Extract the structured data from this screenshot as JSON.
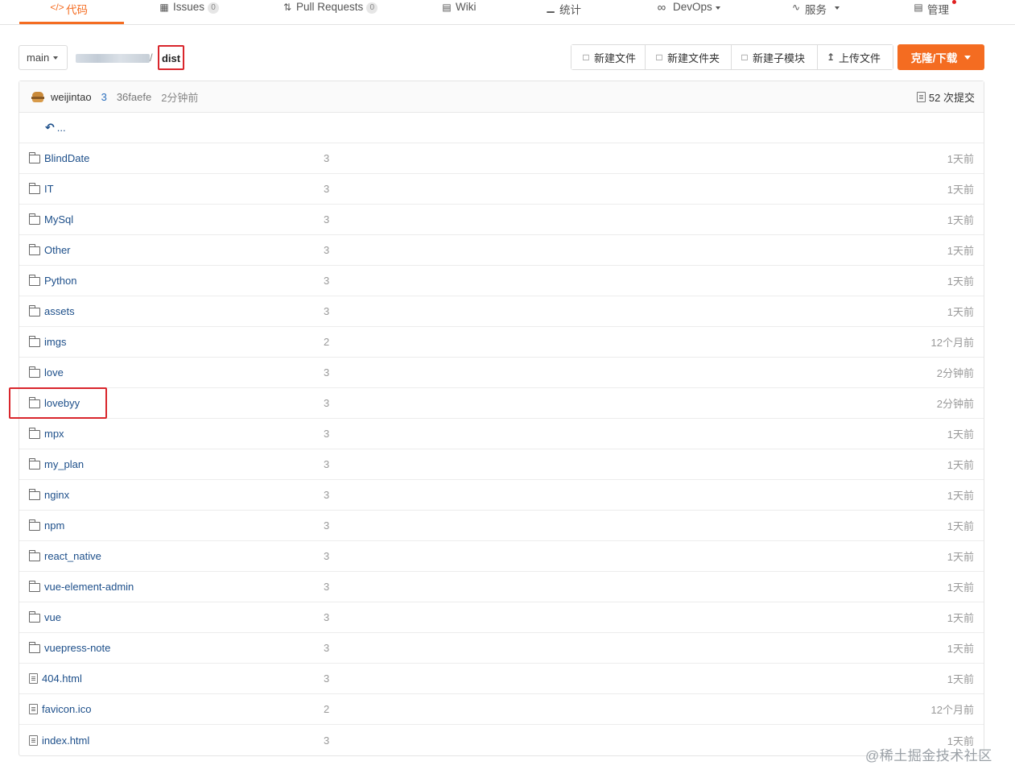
{
  "nav": {
    "tabs": [
      {
        "label": "代码",
        "icon": "code-icon"
      },
      {
        "label": "Issues",
        "count": "0",
        "icon": "issues-icon"
      },
      {
        "label": "Pull Requests",
        "count": "0",
        "icon": "pull-request-icon"
      },
      {
        "label": "Wiki",
        "icon": "wiki-icon"
      },
      {
        "label": "统计",
        "icon": "chart-icon"
      },
      {
        "label": "DevOps",
        "icon": "infinity-icon"
      },
      {
        "label": "服务",
        "icon": "pulse-icon"
      },
      {
        "label": "管理",
        "icon": "manage-icon"
      }
    ]
  },
  "toolbar": {
    "branch": "main",
    "breadcrumb_sep": "/",
    "current_dir": "dist",
    "buttons": [
      {
        "label": "新建文件",
        "icon": "new-file-icon"
      },
      {
        "label": "新建文件夹",
        "icon": "new-folder-icon"
      },
      {
        "label": "新建子模块",
        "icon": "submodule-icon"
      },
      {
        "label": "上传文件",
        "icon": "upload-icon"
      }
    ],
    "clone_label": "克隆/下载"
  },
  "commit": {
    "author": "weijintao",
    "number": "3",
    "hash": "36faefe",
    "time": "2分钟前",
    "commits_label": "52 次提交"
  },
  "back_label": "...",
  "files": [
    {
      "name": "BlindDate",
      "type": "folder",
      "msg": "3",
      "time": "1天前"
    },
    {
      "name": "IT",
      "type": "folder",
      "msg": "3",
      "time": "1天前"
    },
    {
      "name": "MySql",
      "type": "folder",
      "msg": "3",
      "time": "1天前"
    },
    {
      "name": "Other",
      "type": "folder",
      "msg": "3",
      "time": "1天前"
    },
    {
      "name": "Python",
      "type": "folder",
      "msg": "3",
      "time": "1天前"
    },
    {
      "name": "assets",
      "type": "folder",
      "msg": "3",
      "time": "1天前"
    },
    {
      "name": "imgs",
      "type": "folder",
      "msg": "2",
      "time": "12个月前"
    },
    {
      "name": "love",
      "type": "folder",
      "msg": "3",
      "time": "2分钟前"
    },
    {
      "name": "lovebyy",
      "type": "folder",
      "msg": "3",
      "time": "2分钟前"
    },
    {
      "name": "mpx",
      "type": "folder",
      "msg": "3",
      "time": "1天前"
    },
    {
      "name": "my_plan",
      "type": "folder",
      "msg": "3",
      "time": "1天前"
    },
    {
      "name": "nginx",
      "type": "folder",
      "msg": "3",
      "time": "1天前"
    },
    {
      "name": "npm",
      "type": "folder",
      "msg": "3",
      "time": "1天前"
    },
    {
      "name": "react_native",
      "type": "folder",
      "msg": "3",
      "time": "1天前"
    },
    {
      "name": "vue-element-admin",
      "type": "folder",
      "msg": "3",
      "time": "1天前"
    },
    {
      "name": "vue",
      "type": "folder",
      "msg": "3",
      "time": "1天前"
    },
    {
      "name": "vuepress-note",
      "type": "folder",
      "msg": "3",
      "time": "1天前"
    },
    {
      "name": "404.html",
      "type": "file",
      "msg": "3",
      "time": "1天前"
    },
    {
      "name": "favicon.ico",
      "type": "file",
      "msg": "2",
      "time": "12个月前"
    },
    {
      "name": "index.html",
      "type": "file",
      "msg": "3",
      "time": "1天前"
    }
  ],
  "watermark": "@稀土掘金技术社区",
  "colors": {
    "accent": "#f46c21",
    "link": "#1d4f8a",
    "highlight": "#d9262c"
  }
}
